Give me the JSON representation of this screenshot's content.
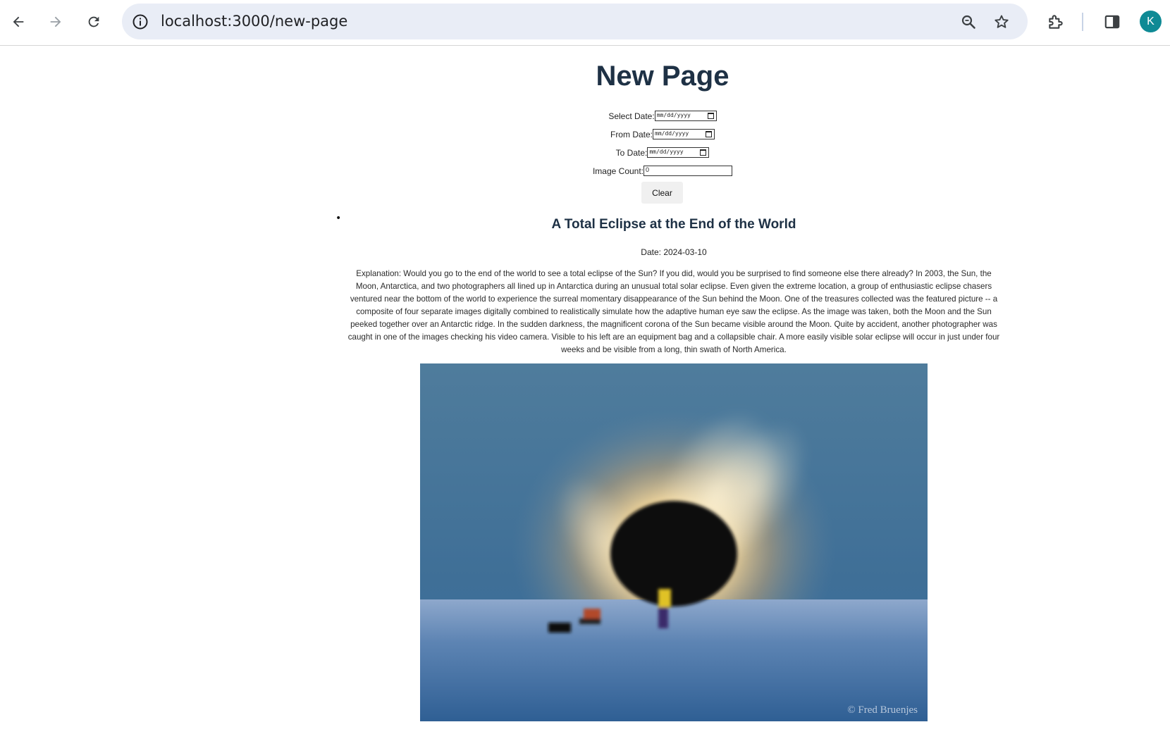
{
  "browser": {
    "url": "localhost:3000/new-page",
    "avatar_initial": "K"
  },
  "page": {
    "title": "New Page",
    "form": {
      "select_date_label": "Select Date:",
      "from_date_label": "From Date:",
      "to_date_label": "To Date:",
      "date_placeholder": "mm/dd/yyyy",
      "image_count_label": "Image Count:",
      "image_count_value": "0",
      "clear_label": "Clear"
    },
    "apod": {
      "title": "A Total Eclipse at the End of the World",
      "date_text": "Date: 2024-03-10",
      "explanation": "Explanation: Would you go to the end of the world to see a total eclipse of the Sun? If you did, would you be surprised to find someone else there already? In 2003, the Sun, the Moon, Antarctica, and two photographers all lined up in Antarctica during an unusual total solar eclipse. Even given the extreme location, a group of enthusiastic eclipse chasers ventured near the bottom of the world to experience the surreal momentary disappearance of the Sun behind the Moon. One of the treasures collected was the featured picture -- a composite of four separate images digitally combined to realistically simulate how the adaptive human eye saw the eclipse. As the image was taken, both the Moon and the Sun peeked together over an Antarctic ridge. In the sudden darkness, the magnificent corona of the Sun became visible around the Moon. Quite by accident, another photographer was caught in one of the images checking his video camera. Visible to his left are an equipment bag and a collapsible chair. A more easily visible solar eclipse will occur in just under four weeks and be visible from a long, thin swath of North America.",
      "image_credit": "© Fred Bruenjes"
    }
  }
}
